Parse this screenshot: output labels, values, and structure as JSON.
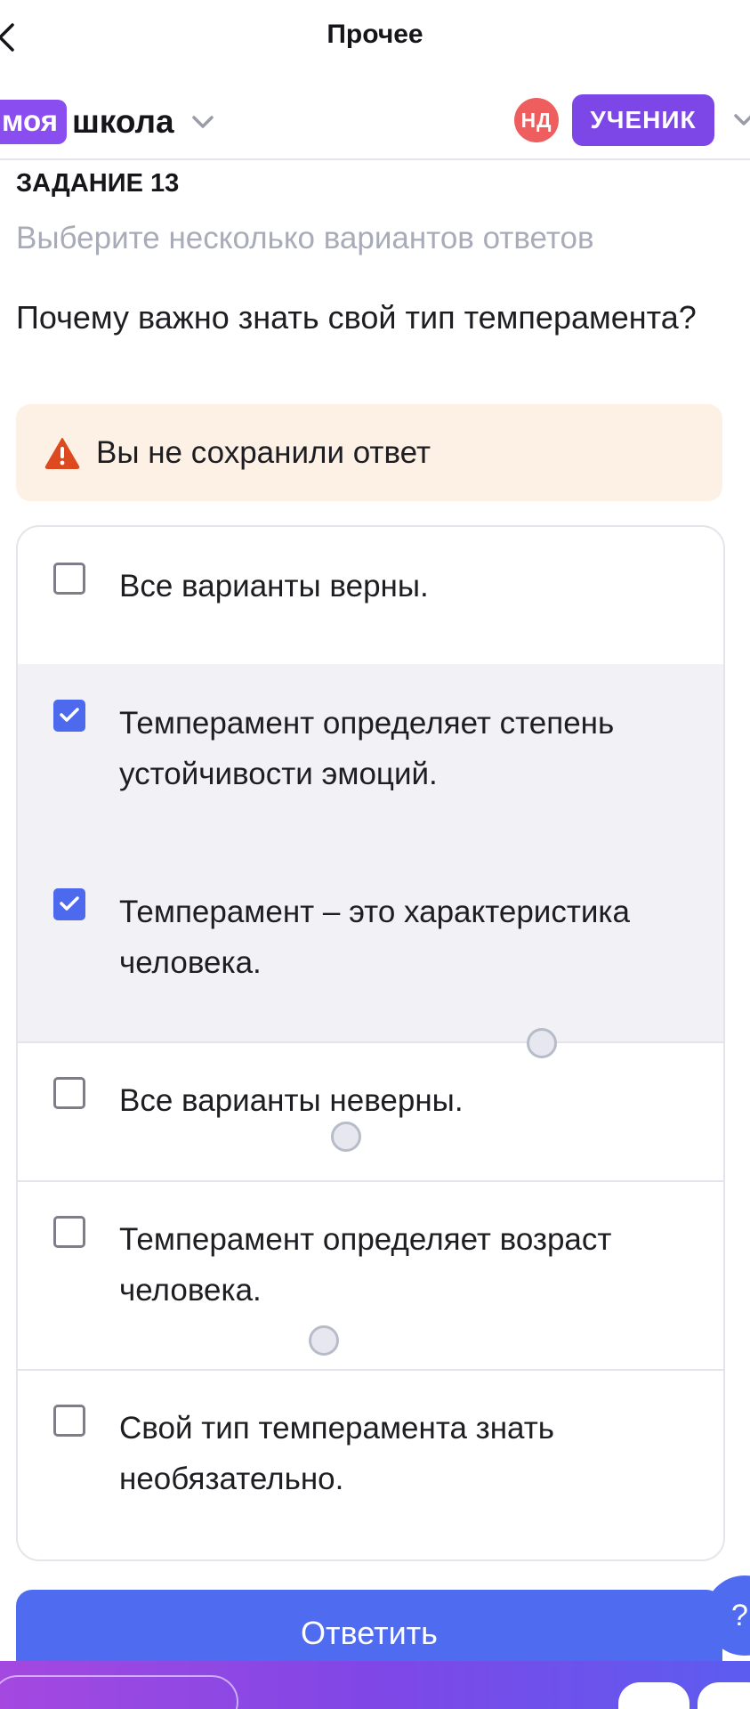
{
  "topbar": {
    "title": "Прочее",
    "back_icon": "chevron-left-icon"
  },
  "header": {
    "logo_badge": "моя",
    "logo_text": "школа",
    "avatar_initials": "НД",
    "role": "УЧЕНИК"
  },
  "task": {
    "number_label": "ЗАДАНИЕ 13",
    "hint": "Выберите несколько вариантов ответов",
    "question": "Почему важно знать свой тип темперамента?"
  },
  "warning": {
    "text": "Вы не сохранили ответ",
    "icon": "warning-triangle-icon"
  },
  "options": [
    {
      "label": "Все варианты верны.",
      "checked": false
    },
    {
      "label": "Темперамент определяет степень устойчивости эмоций.",
      "checked": true
    },
    {
      "label": "Темперамент – это характеристика человека.",
      "checked": true
    },
    {
      "label": "Все варианты неверны.",
      "checked": false
    },
    {
      "label": "Темперамент определяет возраст человека.",
      "checked": false
    },
    {
      "label": "Свой тип темперамента знать необязательно.",
      "checked": false
    }
  ],
  "submit_label": "Ответить",
  "help_label": "?",
  "colors": {
    "accent": "#4f6cf0",
    "brand": "#8a4df0",
    "warning_bg": "#fdf1e6",
    "warning_icon": "#dd4a1f",
    "checked_row": "#f1f1f6"
  }
}
